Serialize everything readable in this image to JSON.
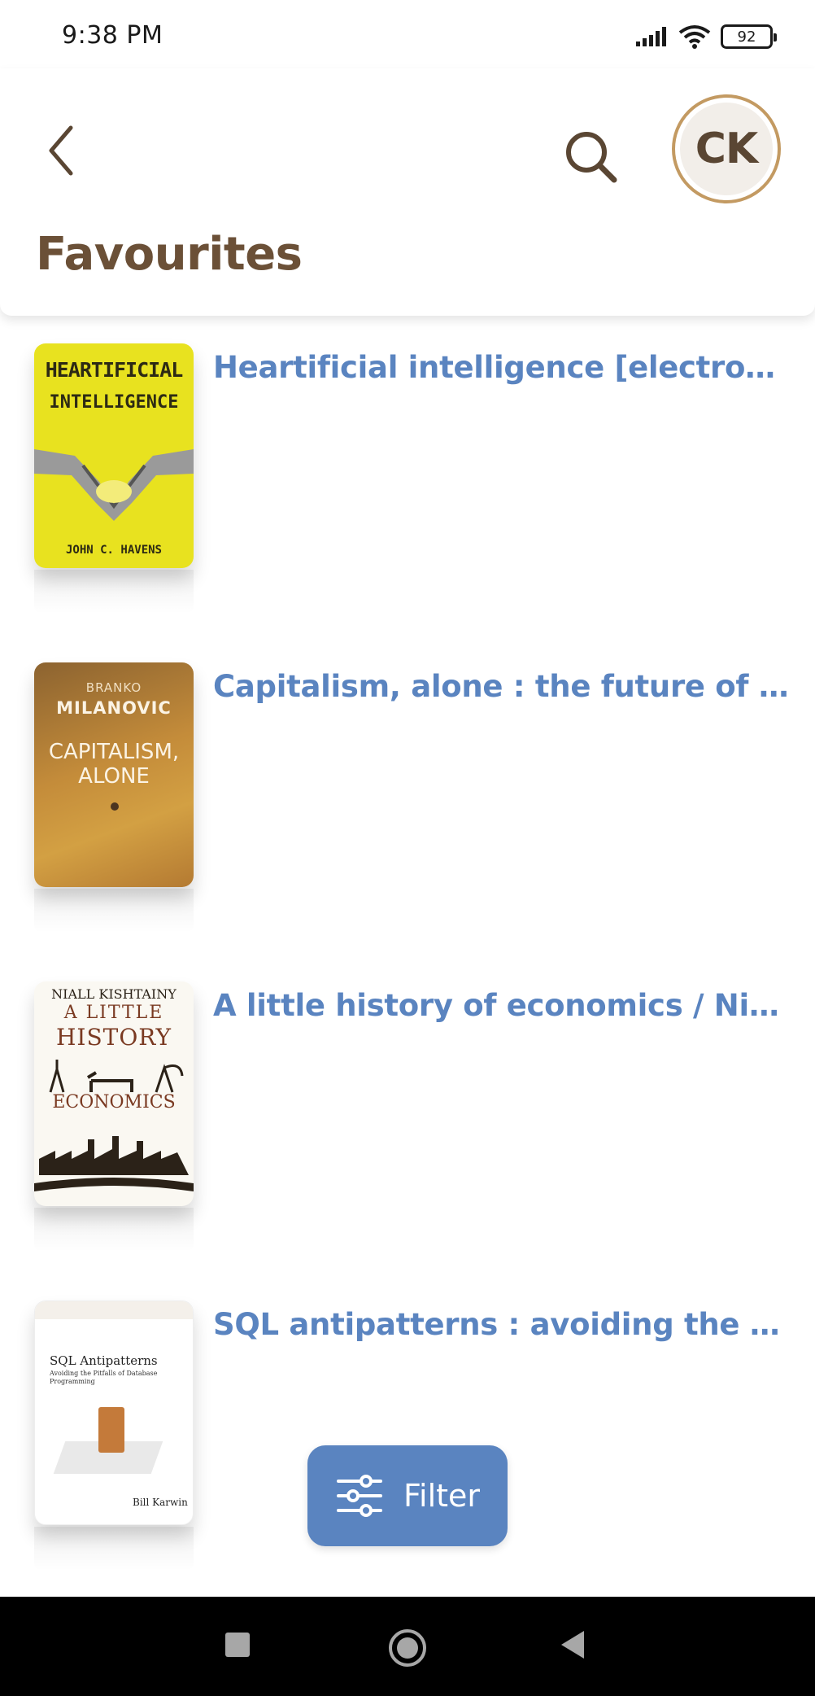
{
  "status_bar": {
    "time": "9:38 PM",
    "battery": "92"
  },
  "header": {
    "title": "Favourites",
    "avatar_initials": "CK",
    "icons": [
      "back-arrow-icon",
      "search-icon"
    ]
  },
  "books": [
    {
      "title": "Heartificial intelligence [electroni...",
      "cover": {
        "line1": "HEARTIFICIAL",
        "line2": "INTELLIGENCE",
        "author": "JOHN C. HAVENS"
      }
    },
    {
      "title": "Capitalism, alone : the future of t...",
      "cover": {
        "line1": "BRANKO",
        "line2": "MILANOVIC",
        "line3": "CAPITALISM, ALONE"
      }
    },
    {
      "title": "A little history of economics / Niall...",
      "cover": {
        "line1": "NIALL KISHTAINY",
        "line2": "A LITTLE",
        "line3": "HISTORY",
        "line4": "ECONOMICS"
      }
    },
    {
      "title": "SQL antipatterns : avoiding the pi...",
      "cover": {
        "line1": "SQL Antipatterns",
        "line2": "Avoiding the Pitfalls of Database Programming",
        "author": "Bill Karwin"
      }
    }
  ],
  "filter_button": {
    "label": "Filter",
    "icon": "sliders-icon"
  },
  "colors": {
    "accent_blue": "#5a84c0",
    "title_brown": "#6b5037",
    "avatar_ring": "#c39a62"
  }
}
